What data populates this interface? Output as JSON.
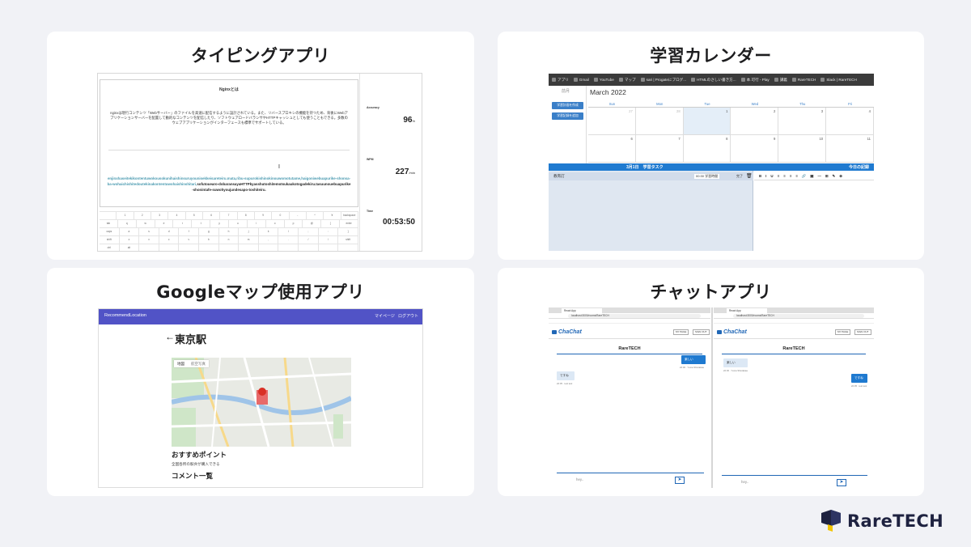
{
  "cards": {
    "typing": {
      "title": "タイピングアプリ",
      "heading": "Nginxとは",
      "sentence": "nginxは現行コンテンツ「Webサーバー」のファイルを高速に配信するように設計されている。また、リバースプロキシの機能を持つため、背後にWebアプリケーションサーバーを配置して動的なコンテンツを配信したり、ソフトウェアロードバランサやHTTPキャッシュとしても使うこともできる。多数のウェブアプリケーションがインターフェースも標準でサポートしている。",
      "romaji_done": "enjinxhaseitekikontentuwokousokunihaishinsuruyounisekkeisareteiru.mata,ribu-supurokishinokinouwomotutame,haigoniwebuapurike-shonsa-ba-wohaichishitedoutekinakontentuwohaishinshitari,",
      "romaji_todo": "sofutouearo-dobaransayaHTTPkyasshutoshitemotsukaukotogadekiru.tasuunouebuapurike-shonintafe-suwohyoujundesapo-toshiteiru.",
      "keyboard_rows": [
        [
          "",
          "1",
          "2",
          "3",
          "4",
          "5",
          "6",
          "7",
          "8",
          "9",
          "0",
          "-",
          "^",
          "¥",
          "backspace"
        ],
        [
          "tab",
          "q",
          "w",
          "e",
          "r",
          "t",
          "y",
          "u",
          "i",
          "o",
          "p",
          "@",
          "[",
          "enter"
        ],
        [
          "caps",
          "a",
          "s",
          "d",
          "f",
          "g",
          "h",
          "j",
          "k",
          "l",
          ";",
          ":",
          "]"
        ],
        [
          "shift",
          "z",
          "x",
          "c",
          "v",
          "b",
          "n",
          "m",
          ",",
          ".",
          "/",
          "\\",
          "shift"
        ],
        [
          "ctrl",
          "alt",
          "",
          "",
          "",
          "",
          "",
          "",
          "",
          "",
          "",
          "",
          ""
        ]
      ],
      "stats": {
        "accuracy_label": "Accuracy",
        "accuracy_value": "96",
        "accuracy_unit": "%",
        "wpm_label": "WPM",
        "wpm_value": "227",
        "wpm_unit": "/min",
        "time_label": "Time",
        "time_value": "00:53:50"
      }
    },
    "calendar": {
      "title": "学習カレンダー",
      "bookmarks": [
        "アプリ",
        "Gmail",
        "YouTube",
        "マップ",
        "sari | Progateにブログ...",
        "HTMLのさしい書き方...",
        "本.可行 - Play",
        "講義",
        "RareTECH",
        "Slack | RareTECH"
      ],
      "prev_label": "前月",
      "btn_create_plan": "学習計画を作成",
      "btn_add_record": "学習記録を追加",
      "month": "March 2022",
      "weekdays": [
        "Sun",
        "Mon",
        "Tue",
        "Wed",
        "Thu",
        "Fri"
      ],
      "week1": [
        "27",
        "28",
        "1",
        "2",
        "3",
        "4"
      ],
      "week2": [
        "6",
        "7",
        "8",
        "9",
        "10",
        "11"
      ],
      "task_header_date": "3月1日",
      "task_header_title": "学習タスク",
      "record_header": "今日の記録",
      "task_name": "教育訂",
      "task_time": "00:30",
      "task_time_suffix": "学習時間",
      "task_done_label": "完了",
      "editor_tools": [
        "B",
        "I",
        "U",
        "≡",
        "≡",
        "≡",
        "≡",
        "🔗",
        "▣",
        "—",
        "⊞",
        "✎",
        "⊗"
      ]
    },
    "map": {
      "title": "Googleマップ使用アプリ",
      "brand": "RecommendLocation",
      "nav_mypage": "マイページ",
      "nav_logout": "ログアウト",
      "station": "東京駅",
      "map_tab": "地図",
      "satellite_tab": "航空写真",
      "section_recommend": "おすすめポイント",
      "recommend_desc": "全国各所の駅弁が購入できる",
      "section_comments": "コメント一覧"
    },
    "chat": {
      "title": "チャットアプリ",
      "tab_label": "React App",
      "address": "localhost:3000/rooms/RareTECH",
      "logo": "ChaChat",
      "btn_mypage": "MY PAGE",
      "btn_signout": "SIGN OUT",
      "room": "RareTECH",
      "left_msgs": [
        {
          "text": "楽しい",
          "meta": "22:30 · Yuma Shiotakaa",
          "side": "right"
        },
        {
          "text": "ですね",
          "meta": "22:35 · test test",
          "side": "left"
        }
      ],
      "right_msgs": [
        {
          "text": "楽しい",
          "meta": "22:30 · Yuma Shiotakaa",
          "side": "left"
        },
        {
          "text": "ですね",
          "meta": "22:35 · test test",
          "side": "right"
        }
      ],
      "input_placeholder_left": "hey..",
      "input_placeholder_right": "hey.."
    }
  },
  "brand": {
    "name": "RareTECH",
    "accent": "#1f7ad0",
    "navy": "#1e2240",
    "yellow": "#f3c500"
  }
}
